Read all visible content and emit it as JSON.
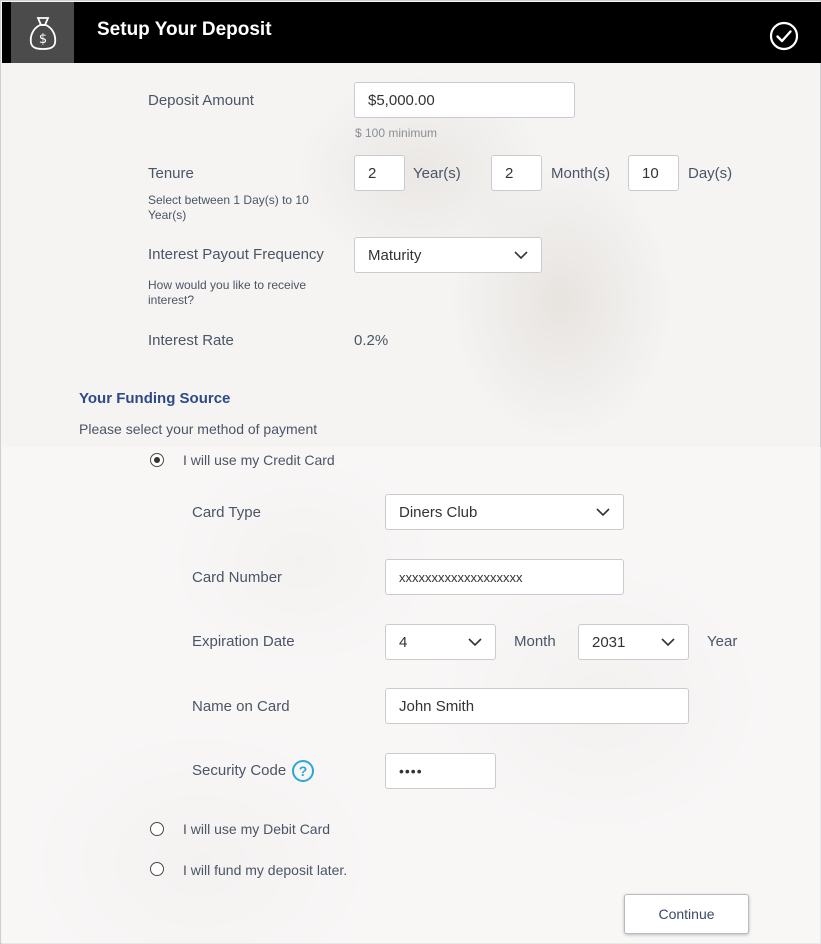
{
  "header": {
    "title": "Setup Your Deposit",
    "icon": "money-bag-icon",
    "confirm_icon": "check-circle-icon"
  },
  "deposit": {
    "amount_label": "Deposit Amount",
    "amount_value": "$5,000.00",
    "minimum_hint": "$ 100 minimum",
    "tenure_label": "Tenure",
    "tenure_hint": "Select between 1 Day(s) to 10 Year(s)",
    "years_value": "2",
    "years_unit": "Year(s)",
    "months_value": "2",
    "months_unit": "Month(s)",
    "days_value": "10",
    "days_unit": "Day(s)",
    "payout_label": "Interest Payout Frequency",
    "payout_hint": "How would you like to receive interest?",
    "payout_value": "Maturity",
    "rate_label": "Interest Rate",
    "rate_value": "0.2%"
  },
  "funding": {
    "title": "Your Funding Source",
    "subtitle": "Please select your method of payment",
    "options": [
      {
        "label": "I will use my Credit Card",
        "selected": true
      },
      {
        "label": "I will use my Debit Card",
        "selected": false
      },
      {
        "label": "I will fund my deposit later.",
        "selected": false
      }
    ],
    "card_type_label": "Card Type",
    "card_type_value": "Diners Club",
    "card_number_label": "Card Number",
    "card_number_value": "xxxxxxxxxxxxxxxxxxx",
    "expiry_label": "Expiration Date",
    "expiry_month_value": "4",
    "expiry_month_unit": "Month",
    "expiry_year_value": "2031",
    "expiry_year_unit": "Year",
    "name_label": "Name on Card",
    "name_value": "John Smith",
    "security_label": "Security Code",
    "security_value": "••••",
    "help_glyph": "?"
  },
  "actions": {
    "continue_label": "Continue"
  },
  "colors": {
    "header_bg": "#000000",
    "accent": "#2e4a86",
    "help": "#2aa7d6"
  }
}
